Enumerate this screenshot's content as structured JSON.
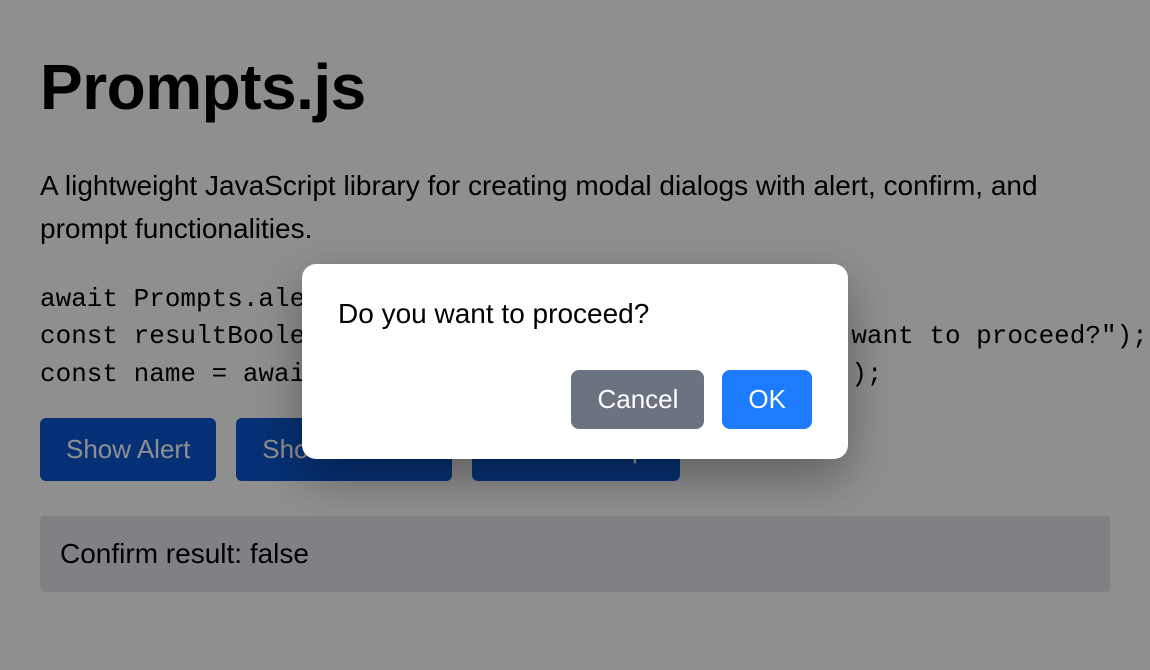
{
  "header": {
    "title": "Prompts.js",
    "lead": "A lightweight JavaScript library for creating modal dialogs with alert, confirm, and prompt functionalities."
  },
  "code": "await Prompts.alert(\"Hello, World!\");\nconst resultBoolean = await Prompts.confirm(\"Do you want to proceed?\");\nconst name = await Prompts.prompt(\"Enter your name:\");",
  "buttons": {
    "alert": "Show Alert",
    "confirm": "Show Confirm",
    "prompt": "Show Prompt"
  },
  "result": {
    "text": "Confirm result: false"
  },
  "dialog": {
    "message": "Do you want to proceed?",
    "cancel": "Cancel",
    "ok": "OK"
  }
}
